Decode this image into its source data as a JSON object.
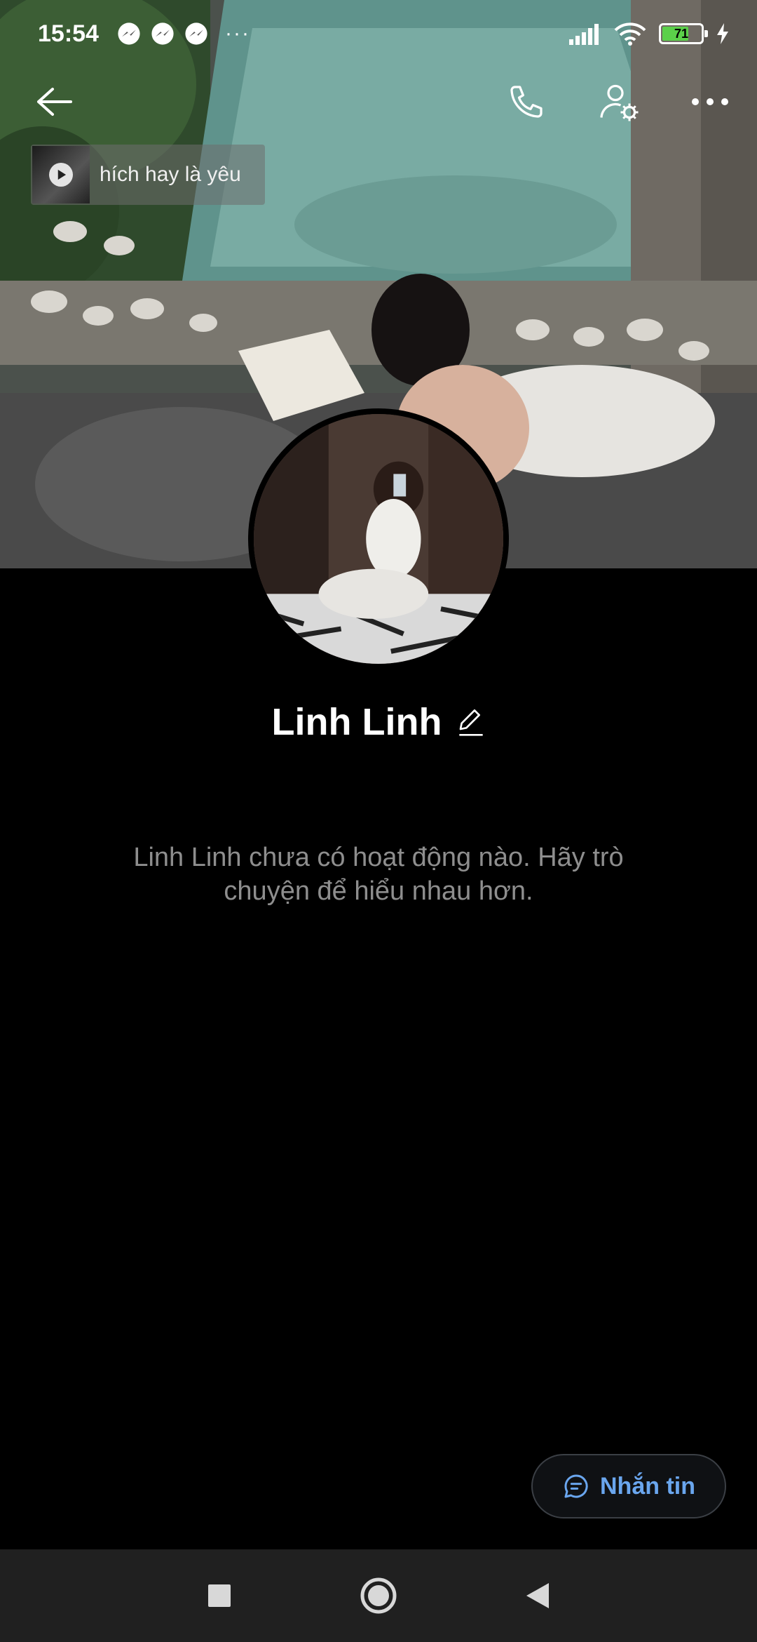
{
  "status_bar": {
    "time": "15:54",
    "notification_icons": [
      "messenger-icon",
      "messenger-icon",
      "messenger-icon"
    ],
    "more_indicator": "···",
    "battery_level": "71",
    "battery_percent": 71
  },
  "toolbar": {
    "back_icon": "arrow-left-icon",
    "call_icon": "phone-icon",
    "settings_icon": "user-settings-icon",
    "more_icon": "more-horizontal-icon"
  },
  "music": {
    "title": "hích hay là yêu"
  },
  "profile": {
    "name": "Linh Linh",
    "empty_message": "Linh Linh chưa có hoạt động nào. Hãy trò chuyện để hiểu nhau hơn."
  },
  "actions": {
    "message_label": "Nhắn tin"
  },
  "colors": {
    "background": "#000000",
    "accent": "#6aa6ee",
    "muted_text": "#8e8e8e",
    "navbar": "#202020",
    "battery": "#5bd04a"
  }
}
